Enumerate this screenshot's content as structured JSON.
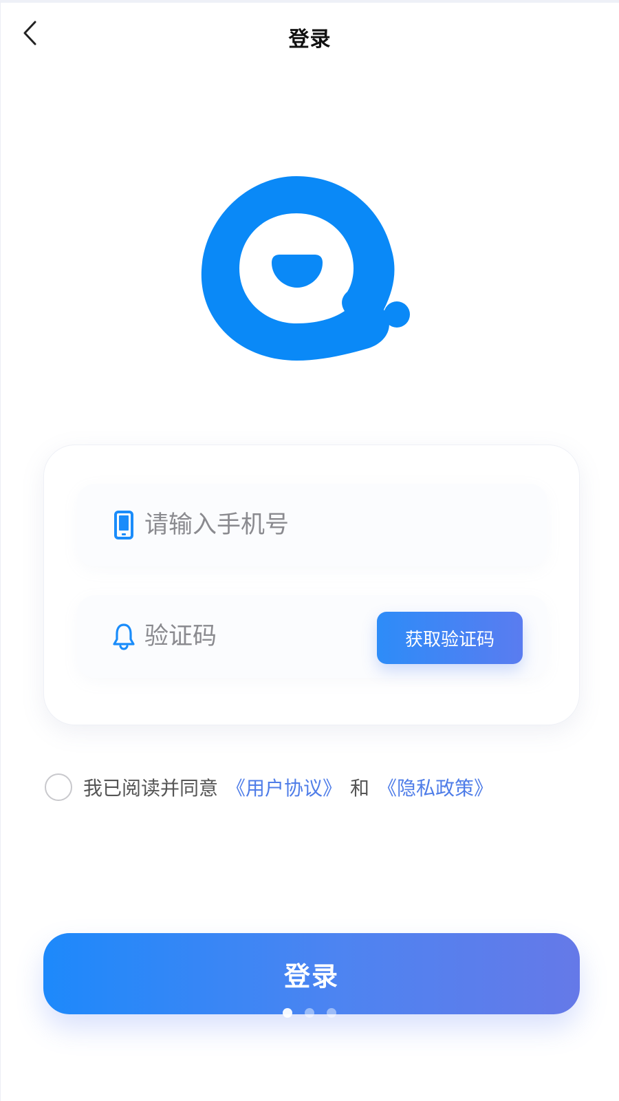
{
  "header": {
    "title": "登录",
    "back_icon": "chevron-left-icon"
  },
  "logo": {
    "icon": "chat-bubble-logo",
    "color": "#0a89f7"
  },
  "form": {
    "phone": {
      "icon": "mobile-phone-icon",
      "placeholder": "请输入手机号",
      "value": ""
    },
    "code": {
      "icon": "bell-icon",
      "placeholder": "验证码",
      "value": "",
      "button_label": "获取验证码"
    }
  },
  "agreement": {
    "checked": false,
    "prefix": "我已阅读并同意",
    "user_agreement": "《用户协议》",
    "conjunction": "和",
    "privacy_policy": "《隐私政策》",
    "link_color": "#4f7de8"
  },
  "login_button": {
    "label": "登录"
  },
  "pager": {
    "count": 3,
    "active_index": 0
  },
  "colors": {
    "accent": "#1a8cfa",
    "gradient_end": "#6579e8"
  }
}
